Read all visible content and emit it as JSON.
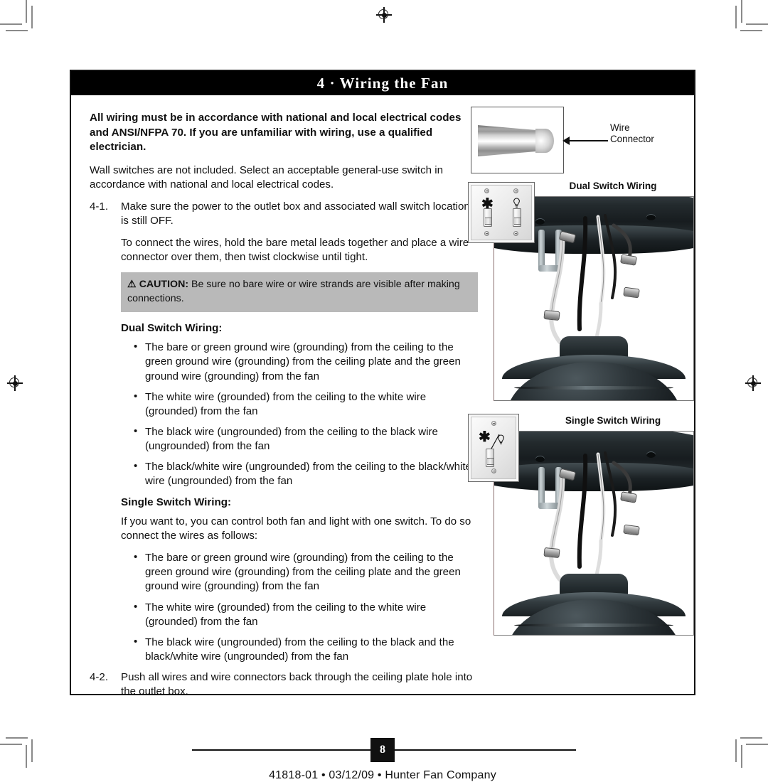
{
  "header": {
    "title": "4 · Wiring the Fan"
  },
  "content": {
    "lead": "All wiring must be in accordance with national and local electrical codes and ANSI/NFPA 70. If you are unfamiliar with wiring, use a qualified electrician.",
    "switch_note": "Wall switches are not included. Select an acceptable general-use switch in accordance with national and local electrical codes.",
    "step_4_1": {
      "number": "4-1.",
      "text": "Make sure the power to the outlet box and associated wall switch location is still OFF."
    },
    "connect_note": "To connect the wires, hold the bare metal leads together and place a wire connector over them, then twist clockwise until tight.",
    "caution": {
      "triangle": "⚠",
      "label": "CAUTION:",
      "text": "Be sure no bare wire or wire strands are visible after making connections."
    },
    "dual_switch": {
      "heading": "Dual Switch Wiring:",
      "bullets": [
        "The bare or green ground wire (grounding) from the ceiling to the green ground wire (grounding) from the ceiling plate and the green ground wire (grounding) from the fan",
        "The white wire (grounded) from the ceiling to the white wire (grounded) from the fan",
        "The black wire (ungrounded) from the ceiling to the black wire (ungrounded) from the fan",
        "The black/white wire (ungrounded) from the ceiling to the black/white wire (ungrounded) from the fan"
      ]
    },
    "single_switch": {
      "heading": "Single Switch Wiring:",
      "intro": "If you want to, you can control both fan and light with one switch. To do so connect the wires as follows:",
      "bullets": [
        "The bare or green ground wire (grounding) from the ceiling to the green ground wire (grounding) from the ceiling plate and the green ground wire (grounding) from the fan",
        "The white wire (grounded) from the ceiling to the white wire (grounded) from the fan",
        "The black wire (ungrounded) from the ceiling to the black and the black/white wire (ungrounded) from the fan"
      ]
    },
    "step_4_2": {
      "number": "4-2.",
      "text": "Push all wires and wire connectors back through the ceiling plate hole into the outlet box."
    }
  },
  "figures": {
    "wire_connector": {
      "label_line1": "Wire",
      "label_line2": "Connector"
    },
    "dual_switch_title": "Dual Switch Wiring",
    "single_switch_title": "Single Switch Wiring"
  },
  "footer": {
    "page_number": "8",
    "line": "41818-01  •  03/12/09  •  Hunter Fan Company"
  }
}
